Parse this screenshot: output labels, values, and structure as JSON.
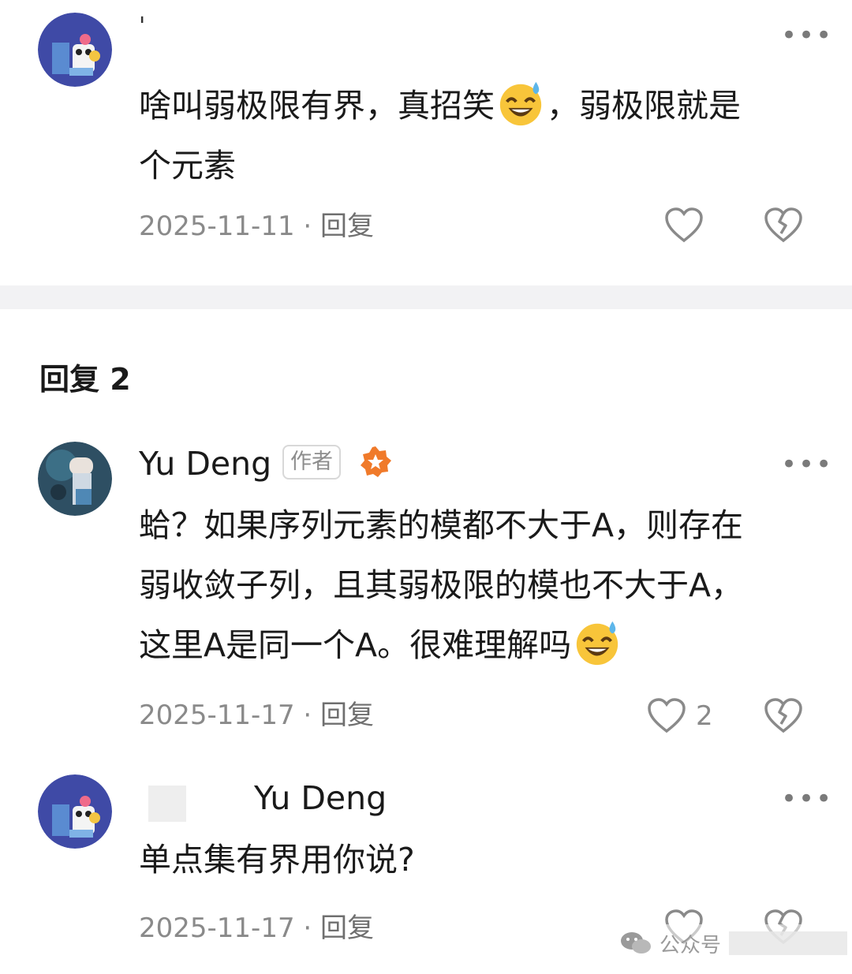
{
  "comments": [
    {
      "username": "'",
      "text_line1_a": "啥叫弱极限有界，真招笑",
      "text_line1_b": "，弱极限就是",
      "text_line2": "个元素",
      "date": "2025-11-11",
      "separator": "·",
      "reply_label": "回复",
      "more_label": "•••"
    }
  ],
  "replies_section": {
    "title": "回复 2"
  },
  "replies": [
    {
      "username": "Yu Deng",
      "author_tag": "作者",
      "line1": "蛤？如果序列元素的模都不大于A，则存在",
      "line2": "弱收敛子列，且其弱极限的模也不大于A，",
      "line3": "这里A是同一个A。很难理解吗",
      "date": "2025-11-17",
      "separator": "·",
      "reply_label": "回复",
      "like_count": "2",
      "more_label": "•••"
    },
    {
      "reply_to": "Yu Deng",
      "text": "单点集有界用你说?",
      "date": "2025-11-17",
      "separator": "·",
      "reply_label": "回复",
      "more_label": "•••"
    }
  ],
  "watermark": {
    "text": "公众号"
  },
  "colors": {
    "background": "#ffffff",
    "divider": "#f2f2f4",
    "text": "#1a1a1a",
    "meta": "#8a8a8a",
    "badge": "#f07a2a"
  }
}
